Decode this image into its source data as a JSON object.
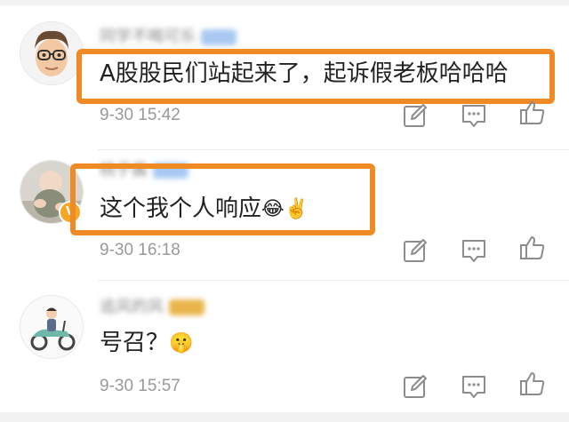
{
  "comments": [
    {
      "username": "同学不喝可乐",
      "username_badge_color": "#a9c9f2",
      "text": "A股股民们站起来了，起诉假老板哈哈哈",
      "time": "9-30 15:42",
      "highlighted": true,
      "avatar_icon": "memoji-avatar-icon"
    },
    {
      "username": "桃子酱",
      "username_badge_color": "#a9c9f2",
      "text": "这个我个人响应",
      "emojis": [
        "😂",
        "✌️"
      ],
      "time": "9-30 16:18",
      "highlighted": true,
      "verified": true,
      "verified_symbol": "V",
      "avatar_icon": "baby-photo-avatar-icon"
    },
    {
      "username": "追风的风",
      "username_badge_color": "#e9b54a",
      "text": "号召？",
      "emojis": [
        "🤫"
      ],
      "time": "9-30 15:57",
      "highlighted": false,
      "avatar_icon": "scooter-rider-avatar-icon"
    }
  ],
  "actions": [
    "edit-icon",
    "comment-icon",
    "thumbs-up-icon"
  ],
  "colors": {
    "highlight": "#f08a24",
    "timestamp": "#999999",
    "text": "#222222",
    "icon": "#8c8c8c"
  }
}
